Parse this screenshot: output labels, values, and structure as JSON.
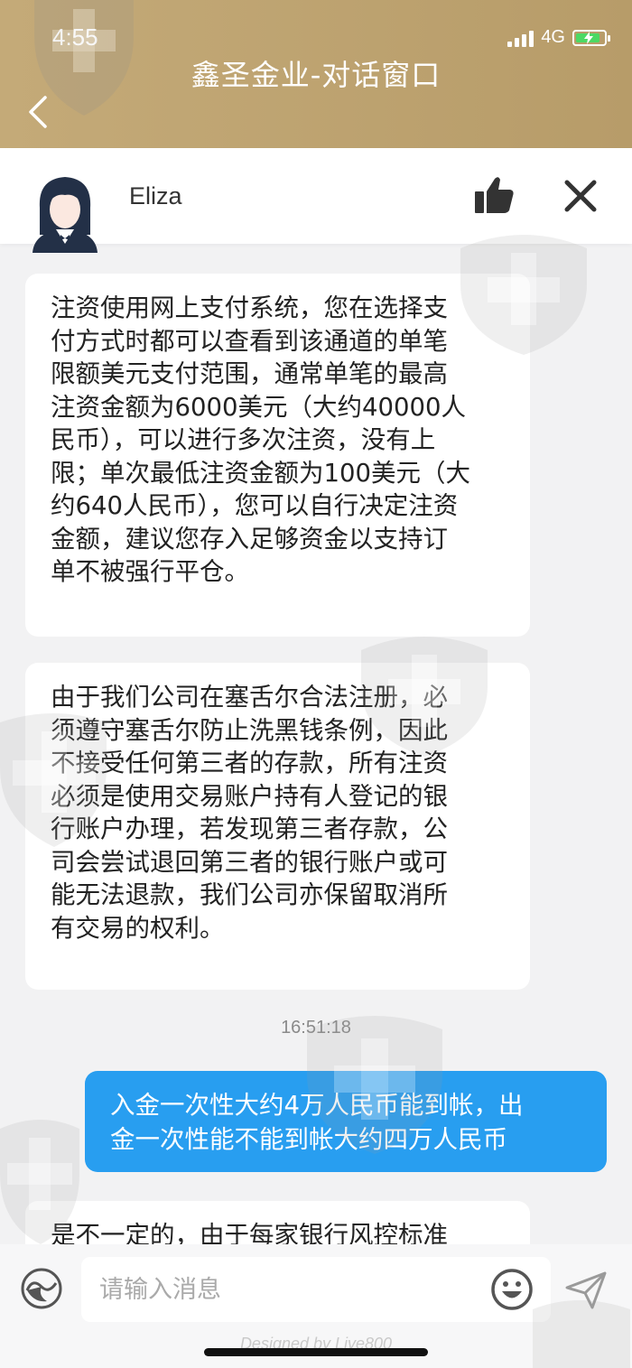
{
  "status_bar": {
    "time": "4:55",
    "network": "4G"
  },
  "header": {
    "title": "鑫圣金业-对话窗口"
  },
  "agent": {
    "name": "Eliza"
  },
  "messages": [
    {
      "from": "agent",
      "text": "注资使用网上支付系统，您在选择支\n付方式时都可以查看到该通道的单笔\n限额美元支付范围，通常单笔的最高\n注资金额为6000美元（大约40000人\n民币），可以进行多次注资，没有上\n限；单次最低注资金额为100美元（大\n约640人民币），您可以自行决定注资\n金额，建议您存入足够资金以支持订\n单不被强行平仓。"
    },
    {
      "from": "agent",
      "text": "由于我们公司在塞舌尔合法注册，必\n须遵守塞舌尔防止洗黑钱条例，因此\n不接受任何第三者的存款，所有注资\n必须是使用交易账户持有人登记的银\n行账户办理，若发现第三者存款，公\n司会尝试退回第三者的银行账户或可\n能无法退款，我们公司亦保留取消所\n有交易的权利。"
    },
    {
      "from": "user",
      "time": "16:51:18",
      "text": "入金一次性大约4万人民币能到帐，出\n金一次性能不能到帐大约四万人民币"
    },
    {
      "from": "agent",
      "text": "是不一定的，由于每家银行风控标准"
    }
  ],
  "input": {
    "placeholder": "请输入消息"
  },
  "footer": {
    "credit": "Designed by Live800"
  },
  "colors": {
    "header": "#bea36f",
    "user_bubble": "#289ef0",
    "background": "#f2f2f3"
  }
}
